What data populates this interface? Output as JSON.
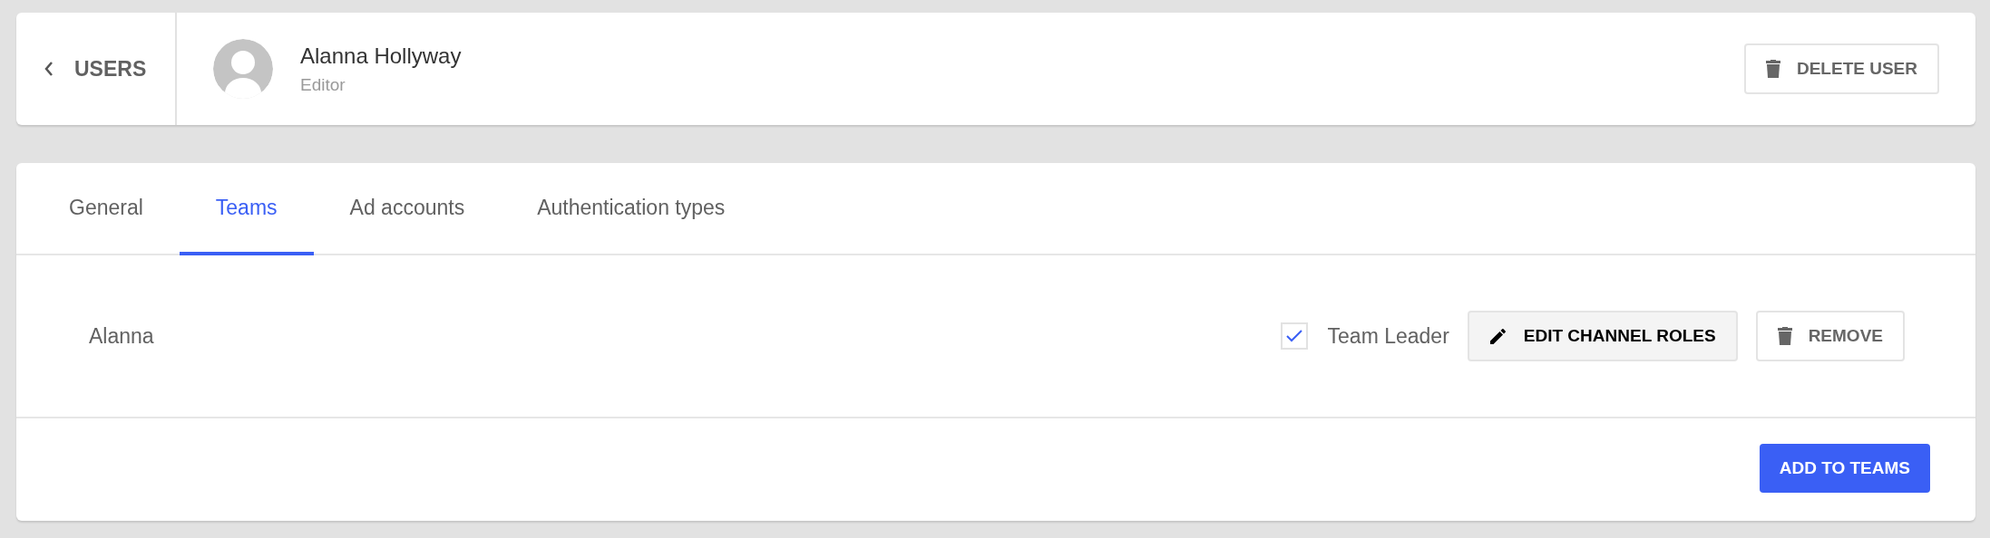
{
  "header": {
    "back_label": "USERS",
    "user_name": "Alanna Hollyway",
    "user_role": "Editor",
    "delete_button": "DELETE USER"
  },
  "tabs": [
    {
      "label": "General",
      "selected": false
    },
    {
      "label": "Teams",
      "selected": true
    },
    {
      "label": "Ad accounts",
      "selected": false
    },
    {
      "label": "Authentication types",
      "selected": false
    }
  ],
  "teams": [
    {
      "name": "Alanna",
      "team_leader": true,
      "leader_label": "Team Leader",
      "edit_button": "EDIT CHANNEL ROLES",
      "remove_button": "REMOVE"
    }
  ],
  "add_button": "ADD TO TEAMS"
}
